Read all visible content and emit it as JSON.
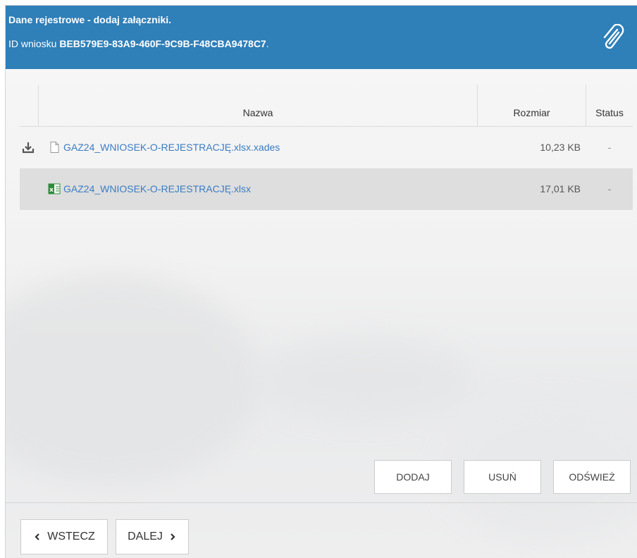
{
  "header": {
    "title": "Dane rejestrowe - dodaj załączniki.",
    "id_label": "ID wniosku",
    "id_value": "BEB579E9-83A9-460F-9C9B-F48CBA9478C7",
    "id_suffix": ".",
    "icon": "paperclip-icon"
  },
  "table": {
    "columns": [
      "Nazwa",
      "Rozmiar",
      "Status"
    ],
    "rows": [
      {
        "name": "GAZ24_WNIOSEK-O-REJESTRACJĘ.xlsx.xades",
        "size": "10,23 KB",
        "status": "-",
        "icon": "document-icon",
        "downloadable": true,
        "selected": false
      },
      {
        "name": "GAZ24_WNIOSEK-O-REJESTRACJĘ.xlsx",
        "size": "17,01 KB",
        "status": "-",
        "icon": "excel-icon",
        "downloadable": false,
        "selected": true
      }
    ]
  },
  "actions": {
    "add_label": "DODAJ",
    "delete_label": "USUŃ",
    "refresh_label": "ODŚWIEŻ"
  },
  "nav": {
    "back_label": "WSTECZ",
    "next_label": "DALEJ"
  },
  "colors": {
    "header_bg": "#2f7fb8",
    "link": "#3a7cc4",
    "selected_row": "#dedede"
  }
}
